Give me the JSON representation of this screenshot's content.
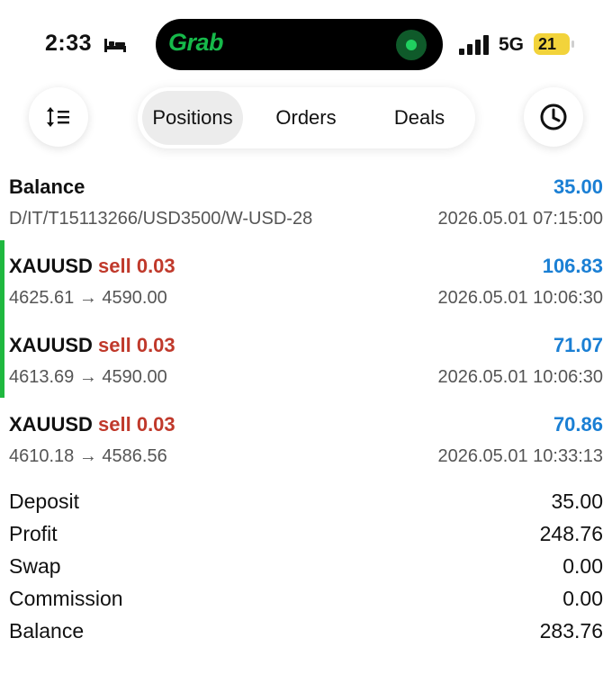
{
  "status_bar": {
    "time": "2:33",
    "grab_label": "Grab",
    "network": "5G",
    "battery": "21"
  },
  "tabs": [
    {
      "label": "Positions",
      "active": true
    },
    {
      "label": "Orders",
      "active": false
    },
    {
      "label": "Deals",
      "active": false
    }
  ],
  "deals": [
    {
      "symbol": "Balance",
      "side": "",
      "amount": "35.00",
      "sub": "D/IT/T15113266/USD3500/W-USD-28",
      "time": "2026.05.01 07:15:00"
    },
    {
      "symbol": "XAUUSD",
      "side": "sell 0.03",
      "amount": "106.83",
      "sub": "4625.61 → 4590.00",
      "time": "2026.05.01 10:06:30"
    },
    {
      "symbol": "XAUUSD",
      "side": "sell 0.03",
      "amount": "71.07",
      "sub": "4613.69 → 4590.00",
      "time": "2026.05.01 10:06:30"
    },
    {
      "symbol": "XAUUSD",
      "side": "sell 0.03",
      "amount": "70.86",
      "sub": "4610.18 → 4586.56",
      "time": "2026.05.01 10:33:13"
    }
  ],
  "summary": [
    {
      "label": "Deposit",
      "value": "35.00"
    },
    {
      "label": "Profit",
      "value": "248.76"
    },
    {
      "label": "Swap",
      "value": "0.00"
    },
    {
      "label": "Commission",
      "value": "0.00"
    },
    {
      "label": "Balance",
      "value": "283.76"
    }
  ],
  "colors": {
    "sell": "#c0392b",
    "amount": "#1a7fd4",
    "highlight_bar": "#1fb83f",
    "grab": "#16b94a"
  }
}
